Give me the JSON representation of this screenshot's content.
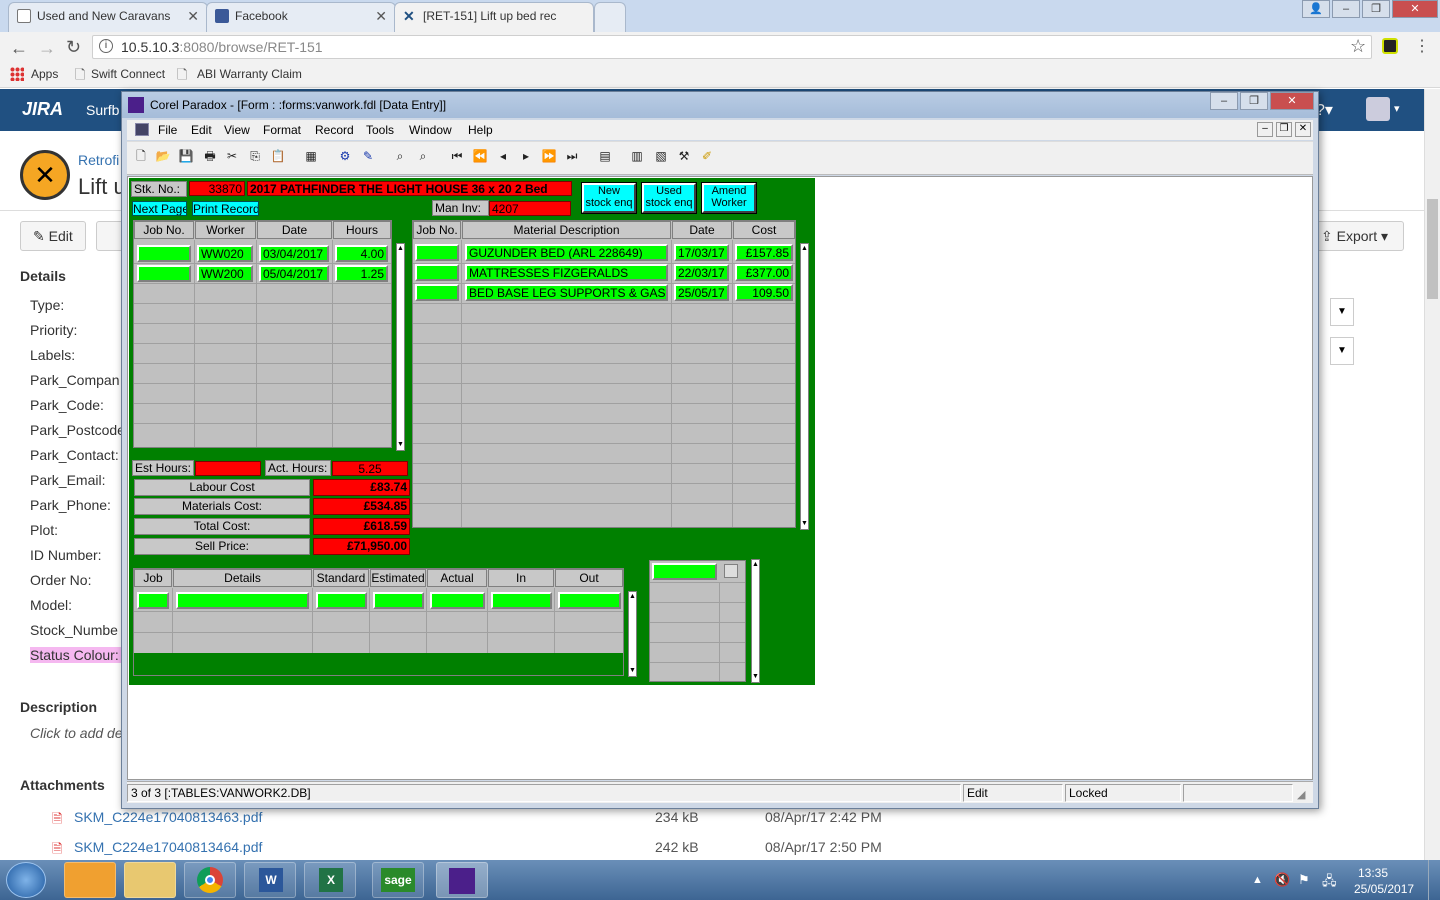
{
  "browser": {
    "tabs": [
      {
        "title": "Used and New Caravans"
      },
      {
        "title": "Facebook"
      },
      {
        "title": "[RET-151] Lift up bed rec"
      }
    ],
    "url_host": "10.5.10.3",
    "url_path": ":8080/browse/RET-151",
    "bookmarks": [
      "Apps",
      "Swift Connect",
      "ABI Warranty Claim"
    ]
  },
  "jira": {
    "logo": "JIRA",
    "project_name": "Surfb",
    "issue_crumb": "Retrofi",
    "issue_title": "Lift u",
    "edit_label": "Edit",
    "export_label": "Export",
    "details_heading": "Details",
    "fields": [
      "Type:",
      "Priority:",
      "Labels:",
      "Park_Compan",
      "Park_Code:",
      "Park_Postcode",
      "Park_Contact:",
      "Park_Email:",
      "Park_Phone:",
      "Plot:",
      "ID Number:",
      "Order No:",
      "Model:",
      "Stock_Numbe",
      "Status Colour:"
    ],
    "description_heading": "Description",
    "description_placeholder": "Click to add de",
    "attachments_heading": "Attachments",
    "attachments": [
      {
        "name": "SKM_C224e17040813463.pdf",
        "size": "234 kB",
        "date": "08/Apr/17 2:42 PM"
      },
      {
        "name": "SKM_C224e17040813464.pdf",
        "size": "242 kB",
        "date": "08/Apr/17 2:50 PM"
      }
    ]
  },
  "paradox": {
    "title": "Corel Paradox - [Form : :forms:vanwork.fdl [Data Entry]]",
    "menu": [
      "File",
      "Edit",
      "View",
      "Format",
      "Record",
      "Tools",
      "Window",
      "Help"
    ],
    "form": {
      "stk_label": "Stk. No.:",
      "stk_no": "33870",
      "description": "2017 PATHFINDER THE LIGHT HOUSE 36 x 20 2 Bed",
      "next_page": "Next Page",
      "print_record": "Print Record",
      "man_inv_label": "Man Inv:",
      "man_inv": "4207",
      "btn_new": "New stock enq",
      "btn_used": "Used stock enq",
      "btn_amend": "Amend Worker",
      "labour_headers": [
        "Job No.",
        "Worker",
        "Date",
        "Hours"
      ],
      "labour_rows": [
        {
          "job": "",
          "worker": "WW020",
          "date": "03/04/2017",
          "hours": "4.00"
        },
        {
          "job": "",
          "worker": "WW200",
          "date": "05/04/2017",
          "hours": "1.25"
        }
      ],
      "material_headers": [
        "Job No.",
        "Material Description",
        "Date",
        "Cost"
      ],
      "material_rows": [
        {
          "job": "",
          "desc": "GUZUNDER BED (ARL 228649)",
          "date": "17/03/17",
          "cost": "£157.85"
        },
        {
          "job": "",
          "desc": "MATTRESSES FIZGERALDS",
          "date": "22/03/17",
          "cost": "£377.00"
        },
        {
          "job": "",
          "desc": "BED BASE LEG SUPPORTS & GAS LIFT",
          "date": "25/05/17",
          "cost": "109.50"
        }
      ],
      "est_hours_label": "Est Hours:",
      "est_hours": "",
      "act_hours_label": "Act. Hours:",
      "act_hours": "5.25",
      "labour_cost_label": "Labour Cost",
      "labour_cost": "£83.74",
      "materials_cost_label": "Materials Cost:",
      "materials_cost": "£534.85",
      "total_cost_label": "Total Cost:",
      "total_cost": "£618.59",
      "sell_price_label": "Sell Price:",
      "sell_price": "£71,950.00",
      "job_headers": [
        "Job",
        "Details",
        "Standard",
        "Estimated",
        "Actual",
        "In",
        "Out"
      ]
    },
    "status": {
      "record": "3 of 3 [:TABLES:VANWORK2.DB]",
      "mode": "Edit",
      "lock": "Locked"
    }
  },
  "taskbar": {
    "time": "13:35",
    "date": "25/05/2017"
  }
}
